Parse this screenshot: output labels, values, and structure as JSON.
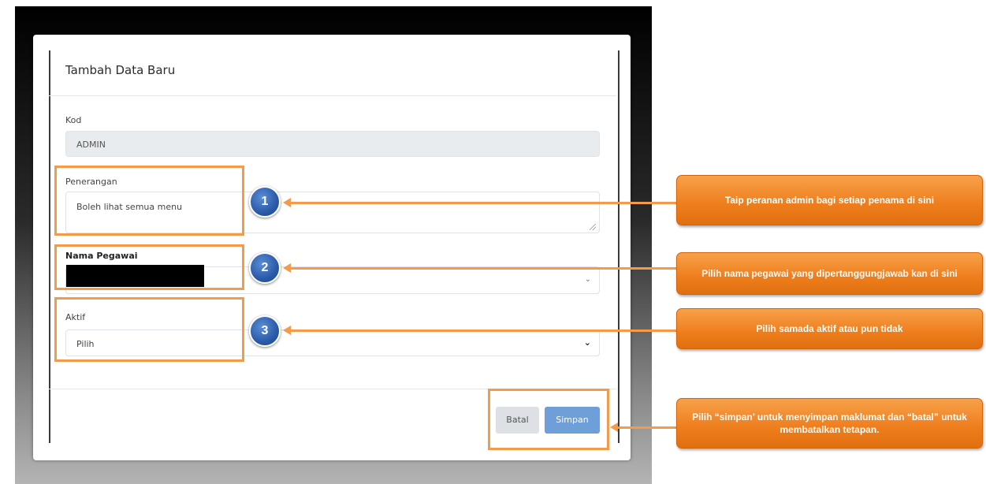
{
  "modal": {
    "title": "Tambah Data Baru",
    "kod": {
      "label": "Kod",
      "value": "ADMIN"
    },
    "penerangan": {
      "label": "Penerangan",
      "value": "Boleh lihat semua menu"
    },
    "nama_pegawai": {
      "label": "Nama Pegawai"
    },
    "aktif": {
      "label": "Aktif",
      "selected": "Pilih"
    },
    "buttons": {
      "batal": "Batal",
      "simpan": "Simpan"
    }
  },
  "steps": [
    "1",
    "2",
    "3"
  ],
  "callouts": {
    "c1": "Taip peranan admin bagi setiap penama di sini",
    "c2": "Pilih nama pegawai yang dipertanggungjawab kan di sini",
    "c3": "Pilih samada aktif atau pun tidak",
    "c4": "Pilih “simpan’ untuk menyimpan maklumat dan “batal” untuk membatalkan tetapan."
  },
  "colors": {
    "highlight": "#f39a4b",
    "callout": "#ee7d1c",
    "step_badge": "#2a5aa8",
    "primary_button": "#6f9fd8"
  }
}
